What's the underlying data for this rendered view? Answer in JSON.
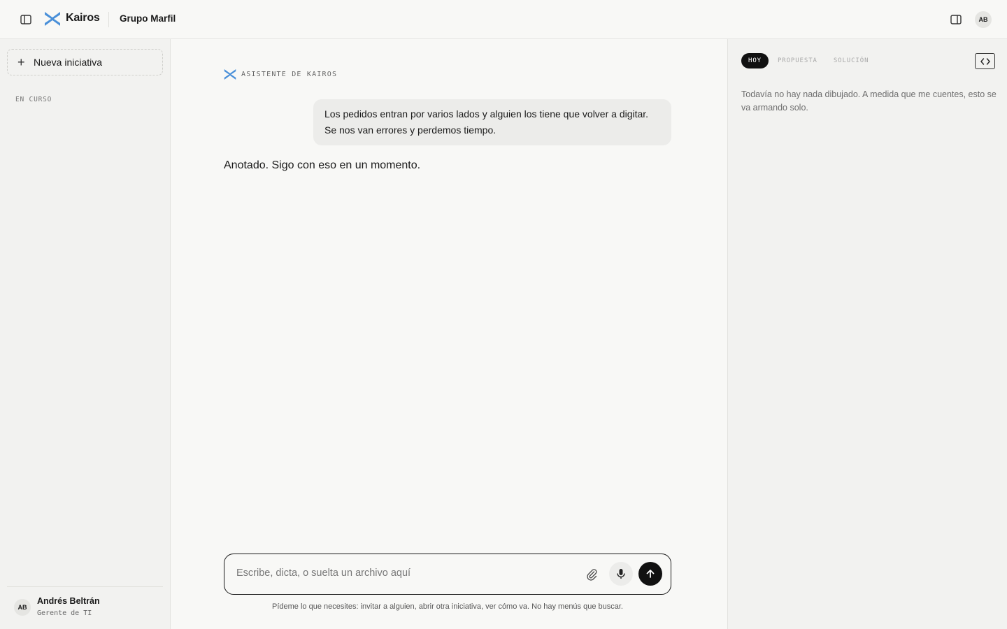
{
  "header": {
    "brand": "Kairos",
    "organization": "Grupo Marfil",
    "user_initials": "AB",
    "icons": {
      "sidebar_toggle": "sidebar-toggle-icon",
      "logo": "kairos-logo-icon",
      "panel_toggle": "panel-toggle-icon"
    }
  },
  "sidebar": {
    "new_button_label": "Nueva iniciativa",
    "section_label": "EN CURSO",
    "user": {
      "initials": "AB",
      "name": "Andrés Beltrán",
      "role": "Gerente de TI"
    }
  },
  "chat": {
    "assistant_label": "ASISTENTE DE KAIROS",
    "messages": [
      {
        "role": "user",
        "text": "Los pedidos entran por varios lados y alguien los tiene que volver a digitar. Se nos van errores y perdemos tiempo."
      },
      {
        "role": "assistant",
        "text": "Anotado. Sigo con eso en un momento."
      }
    ],
    "composer": {
      "placeholder": "Escribe, dicta, o suelta un archivo aquí"
    },
    "hint": "Pídeme lo que necesites: invitar a alguien, abrir otra iniciativa, ver cómo va. No hay menús que buscar."
  },
  "panel": {
    "tabs": [
      {
        "label": "HOY",
        "active": true
      },
      {
        "label": "PROPUESTA",
        "active": false
      },
      {
        "label": "SOLUCIÓN",
        "active": false
      }
    ],
    "empty_text": "Todavía no hay nada dibujado. A medida que me cuentes, esto se va armando solo."
  },
  "colors": {
    "brand_blue": "#4a90d9",
    "background": "#f8f8f6",
    "sidebar_bg": "#f2f2f0",
    "accent_dark": "#111111"
  }
}
